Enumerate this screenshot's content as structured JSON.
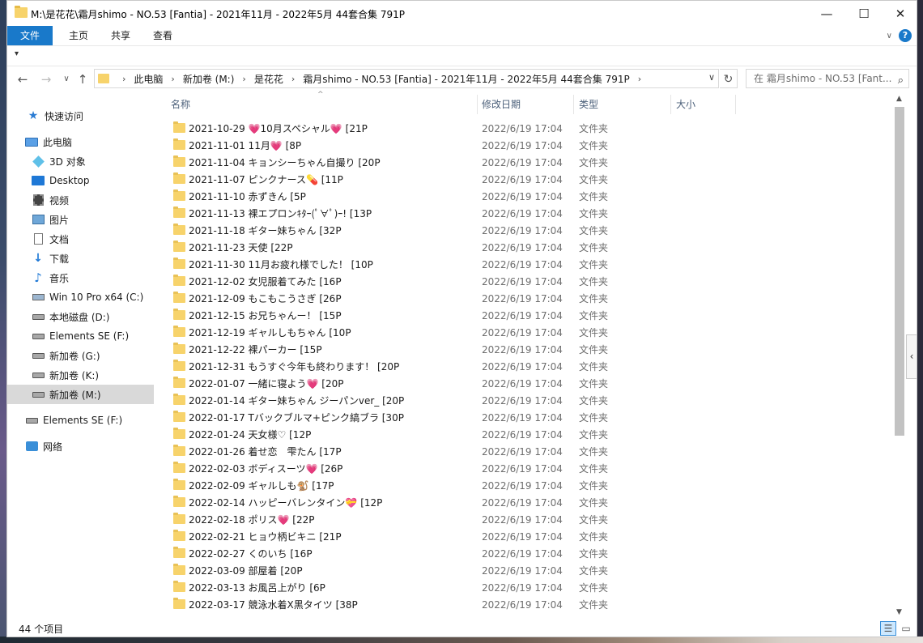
{
  "window": {
    "title": "M:\\是花花\\霜月shimo - NO.53 [Fantia] - 2021年11月 - 2022年5月 44套合集  791P",
    "minimize": "—",
    "maximize": "☐",
    "close": "✕"
  },
  "ribbon": {
    "tabs": [
      "文件",
      "主页",
      "共享",
      "查看"
    ],
    "help": "?",
    "expand": "∨"
  },
  "quick_toolbar": {
    "customize": "▾"
  },
  "nav": {
    "back": "←",
    "forward": "→",
    "recent": "∨",
    "up": "↑",
    "refresh": "↻"
  },
  "address": {
    "crumbs": [
      "此电脑",
      "新加卷 (M:)",
      "是花花",
      "霜月shimo - NO.53 [Fantia] - 2021年11月 - 2022年5月 44套合集  791P"
    ],
    "separator": "›"
  },
  "search": {
    "placeholder": "在 霜月shimo - NO.53 [Fant..."
  },
  "sidebar": {
    "items": [
      {
        "label": "快速访问",
        "icon": "star-icon"
      },
      {
        "label": "此电脑",
        "icon": "pc-icon"
      },
      {
        "label": "3D 对象",
        "icon": "3d-objects-icon"
      },
      {
        "label": "Desktop",
        "icon": "desktop-icon"
      },
      {
        "label": "视频",
        "icon": "video-icon"
      },
      {
        "label": "图片",
        "icon": "pictures-icon"
      },
      {
        "label": "文档",
        "icon": "documents-icon"
      },
      {
        "label": "下载",
        "icon": "download-icon"
      },
      {
        "label": "音乐",
        "icon": "music-icon"
      },
      {
        "label": "Win 10 Pro x64 (C:)",
        "icon": "drive-icon"
      },
      {
        "label": "本地磁盘 (D:)",
        "icon": "drive-icon"
      },
      {
        "label": "Elements SE (F:)",
        "icon": "drive-icon"
      },
      {
        "label": "新加卷 (G:)",
        "icon": "drive-icon"
      },
      {
        "label": "新加卷 (K:)",
        "icon": "drive-icon"
      },
      {
        "label": "新加卷 (M:)",
        "icon": "drive-icon"
      },
      {
        "label": "Elements SE (F:)",
        "icon": "drive-icon"
      },
      {
        "label": "网络",
        "icon": "network-icon"
      }
    ],
    "selected_index": 14
  },
  "columns": {
    "name": "名称",
    "date": "修改日期",
    "type": "类型",
    "size": "大小",
    "sort_indicator": "^"
  },
  "files": [
    {
      "name": "2021-10-29 💗10月スペシャル💗 [21P",
      "date": "2022/6/19 17:04",
      "type": "文件夹"
    },
    {
      "name": "2021-11-01 11月💗 [8P",
      "date": "2022/6/19 17:04",
      "type": "文件夹"
    },
    {
      "name": "2021-11-04 キョンシーちゃん自撮り [20P",
      "date": "2022/6/19 17:04",
      "type": "文件夹"
    },
    {
      "name": "2021-11-07 ピンクナース💊 [11P",
      "date": "2022/6/19 17:04",
      "type": "文件夹"
    },
    {
      "name": "2021-11-10 赤ずきん [5P",
      "date": "2022/6/19 17:04",
      "type": "文件夹"
    },
    {
      "name": "2021-11-13 裸エプロンｷﾀｰ(ﾟ∀ﾟ)ｰ! [13P",
      "date": "2022/6/19 17:04",
      "type": "文件夹"
    },
    {
      "name": "2021-11-18 ギター妹ちゃん [32P",
      "date": "2022/6/19 17:04",
      "type": "文件夹"
    },
    {
      "name": "2021-11-23 天使 [22P",
      "date": "2022/6/19 17:04",
      "type": "文件夹"
    },
    {
      "name": "2021-11-30 11月お疲れ様でした！ [10P",
      "date": "2022/6/19 17:04",
      "type": "文件夹"
    },
    {
      "name": "2021-12-02 女児服着てみた [16P",
      "date": "2022/6/19 17:04",
      "type": "文件夹"
    },
    {
      "name": "2021-12-09 もこもこうさぎ [26P",
      "date": "2022/6/19 17:04",
      "type": "文件夹"
    },
    {
      "name": "2021-12-15 お兄ちゃんー！ [15P",
      "date": "2022/6/19 17:04",
      "type": "文件夹"
    },
    {
      "name": "2021-12-19 ギャルしもちゃん [10P",
      "date": "2022/6/19 17:04",
      "type": "文件夹"
    },
    {
      "name": "2021-12-22 裸パーカー [15P",
      "date": "2022/6/19 17:04",
      "type": "文件夹"
    },
    {
      "name": "2021-12-31 もうすぐ今年も終わります！ [20P",
      "date": "2022/6/19 17:04",
      "type": "文件夹"
    },
    {
      "name": "2022-01-07 一緒に寝よう💗 [20P",
      "date": "2022/6/19 17:04",
      "type": "文件夹"
    },
    {
      "name": "2022-01-14 ギター妹ちゃん ジーパンver_ [20P",
      "date": "2022/6/19 17:04",
      "type": "文件夹"
    },
    {
      "name": "2022-01-17 Tバックブルマ+ピンク縞ブラ [30P",
      "date": "2022/6/19 17:04",
      "type": "文件夹"
    },
    {
      "name": "2022-01-24 天女様♡ [12P",
      "date": "2022/6/19 17:04",
      "type": "文件夹"
    },
    {
      "name": "2022-01-26 着せ恋　雫たん [17P",
      "date": "2022/6/19 17:04",
      "type": "文件夹"
    },
    {
      "name": "2022-02-03 ボディスーツ💗 [26P",
      "date": "2022/6/19 17:04",
      "type": "文件夹"
    },
    {
      "name": "2022-02-09 ギャルしも🐒 [17P",
      "date": "2022/6/19 17:04",
      "type": "文件夹"
    },
    {
      "name": "2022-02-14 ハッピーバレンタイン💝 [12P",
      "date": "2022/6/19 17:04",
      "type": "文件夹"
    },
    {
      "name": "2022-02-18 ポリス💗 [22P",
      "date": "2022/6/19 17:04",
      "type": "文件夹"
    },
    {
      "name": "2022-02-21 ヒョウ柄ビキニ [21P",
      "date": "2022/6/19 17:04",
      "type": "文件夹"
    },
    {
      "name": "2022-02-27 くのいち [16P",
      "date": "2022/6/19 17:04",
      "type": "文件夹"
    },
    {
      "name": "2022-03-09 部屋着 [20P",
      "date": "2022/6/19 17:04",
      "type": "文件夹"
    },
    {
      "name": "2022-03-13 お風呂上がり [6P",
      "date": "2022/6/19 17:04",
      "type": "文件夹"
    },
    {
      "name": "2022-03-17 競泳水着X黒タイツ [38P",
      "date": "2022/6/19 17:04",
      "type": "文件夹"
    }
  ],
  "status": {
    "item_count": "44 个项目"
  },
  "scrollbar": {
    "up": "▲",
    "down": "▼",
    "handle": "‹"
  },
  "views": {
    "details": "☰",
    "tiles": "▭"
  }
}
